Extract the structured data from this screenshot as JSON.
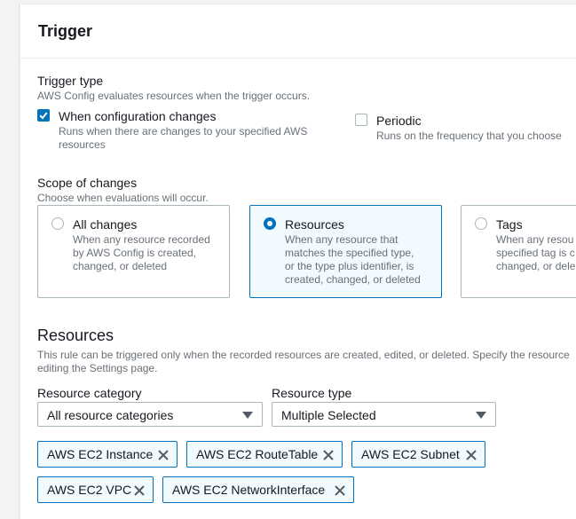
{
  "panel": {
    "title": "Trigger"
  },
  "trigger_type": {
    "label": "Trigger type",
    "description": "AWS Config evaluates resources when the trigger occurs.",
    "options": [
      {
        "label": "When configuration changes",
        "description_line1": "Runs when there are changes to your specified AWS",
        "description_line2": "resources",
        "checked": true
      },
      {
        "label": "Periodic",
        "description_line1": "Runs on the frequency that you choose",
        "checked": false
      }
    ]
  },
  "scope": {
    "label": "Scope of changes",
    "description": "Choose when evaluations will occur.",
    "cards": [
      {
        "title": "All changes",
        "desc": [
          "When any resource recorded",
          "by AWS Config is created,",
          "changed, or deleted"
        ],
        "selected": false
      },
      {
        "title": "Resources",
        "desc": [
          "When any resource that",
          "matches the specified type,",
          "or the type plus identifier, is",
          "created, changed, or deleted"
        ],
        "selected": true
      },
      {
        "title": "Tags",
        "desc": [
          "When any resou",
          "specified tag is c",
          "changed, or dele"
        ],
        "selected": false
      }
    ]
  },
  "resources": {
    "heading": "Resources",
    "description_line1": "This rule can be triggered only when the recorded resources are created, edited, or deleted. Specify the resource",
    "description_line2": "editing the Settings page.",
    "category_label": "Resource category",
    "category_value": "All resource categories",
    "type_label": "Resource type",
    "type_value": "Multiple Selected",
    "tokens": [
      "AWS EC2 Instance",
      "AWS EC2 RouteTable",
      "AWS EC2 Subnet",
      "AWS EC2 VPC",
      "AWS EC2 NetworkInterface"
    ]
  },
  "colors": {
    "accent": "#0073bb",
    "selected_bg": "#f1faff",
    "border": "#aab7b8",
    "muted_text": "#687078"
  },
  "icons": {
    "check": "check-icon",
    "caret": "chevron-down-icon",
    "remove": "close-icon"
  }
}
